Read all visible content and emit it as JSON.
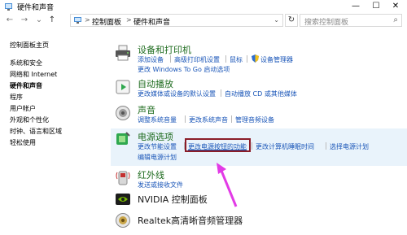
{
  "window": {
    "title": "硬件和声音",
    "minimize": "—",
    "maximize": "☐",
    "close": "✕"
  },
  "nav": {
    "back": "←",
    "forward": "→",
    "down": "⌄",
    "up": "↑",
    "refresh": "↻"
  },
  "address": {
    "crumbs": [
      "控制面板",
      "硬件和声音"
    ],
    "sep": ">"
  },
  "search": {
    "placeholder": "搜索控制面板",
    "icon": "search-icon"
  },
  "sidebar": {
    "items": [
      {
        "label": "控制面板主页"
      },
      {
        "label": "系统和安全"
      },
      {
        "label": "网络和 Internet"
      },
      {
        "label": "硬件和声音"
      },
      {
        "label": "程序"
      },
      {
        "label": "用户帐户"
      },
      {
        "label": "外观和个性化"
      },
      {
        "label": "时钟、语言和区域"
      },
      {
        "label": "轻松使用"
      }
    ]
  },
  "categories": {
    "devices": {
      "title": "设备和打印机",
      "links": [
        "添加设备",
        "高级打印机设置",
        "鼠标",
        "设备管理器"
      ],
      "links2": [
        "更改 Windows To Go 启动选项"
      ]
    },
    "autoplay": {
      "title": "自动播放",
      "links": [
        "更改媒体或设备的默认设置",
        "自动播放 CD 或其他媒体"
      ]
    },
    "sound": {
      "title": "声音",
      "links": [
        "调整系统音量",
        "更改系统声音",
        "管理音频设备"
      ]
    },
    "power": {
      "title": "电源选项",
      "links": [
        "更改节能设置",
        "更改电源按钮的功能",
        "更改计算机睡眠时间",
        "选择电源计划"
      ],
      "links2": [
        "编辑电源计划"
      ]
    },
    "infrared": {
      "title": "红外线",
      "links": [
        "发送或接收文件"
      ]
    },
    "nvidia": {
      "title": "NVIDIA 控制面板"
    },
    "realtek": {
      "title": "Realtek高清晰音频管理器"
    }
  },
  "colors": {
    "link": "#1a56b8",
    "category_title": "#1e6b1e",
    "highlight": "#e9f3fb",
    "annotation_box": "#8b1d28",
    "annotation_arrow": "#e23be6"
  }
}
